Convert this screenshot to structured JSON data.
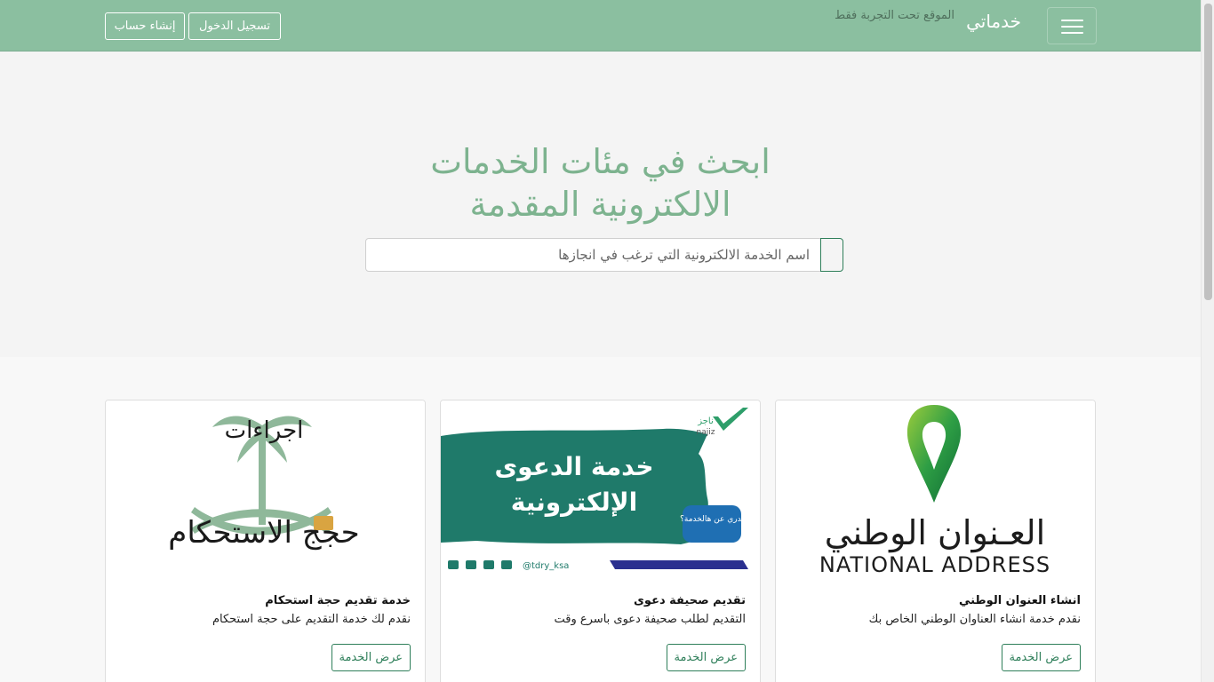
{
  "navbar": {
    "brand": "خدماتي",
    "beta_note": "الموقع تحت التجربة فقط",
    "login_label": "تسجيل الدخول",
    "register_label": "إنشاء حساب"
  },
  "hero": {
    "title_line1": "ابحث في مئات الخدمات",
    "title_line2": "الالكترونية المقدمة",
    "search_placeholder": "اسم الخدمة الالكترونية التي ترغب في انجازها"
  },
  "cards": [
    {
      "title": "انشاء العنوان الوطني",
      "text": "نقدم خدمة انشاء العناوان الوطني الخاص بك",
      "button": "عرض الخدمة",
      "image_ar": "العـنوان الوطني",
      "image_en": "NATIONAL ADDRESS"
    },
    {
      "title": "تقديم صحيفة دعوى",
      "text": "التقديم لطلب صحيفة دعوى باسرع وقت",
      "button": "عرض الخدمة",
      "image_line1": "خدمة الدعوى",
      "image_line2": "الإلكترونية",
      "image_badge": "تدري عن هالخدمة؟",
      "image_handle": "@tdry_ksa",
      "image_logo": "ناجز",
      "image_logo_en": "najiz"
    },
    {
      "title": "خدمة تقديم حجة استحكام",
      "text": "نقدم لك خدمة التقديم على حجة استحكام",
      "button": "عرض الخدمة",
      "image_line1": "اجراءات",
      "image_line2": "حجج الاستحكام"
    }
  ],
  "colors": {
    "navbar": "#8bbfa0",
    "accent": "#2f7f5a",
    "hero_text": "#7db38f",
    "najiz_green": "#1f7a6a"
  }
}
